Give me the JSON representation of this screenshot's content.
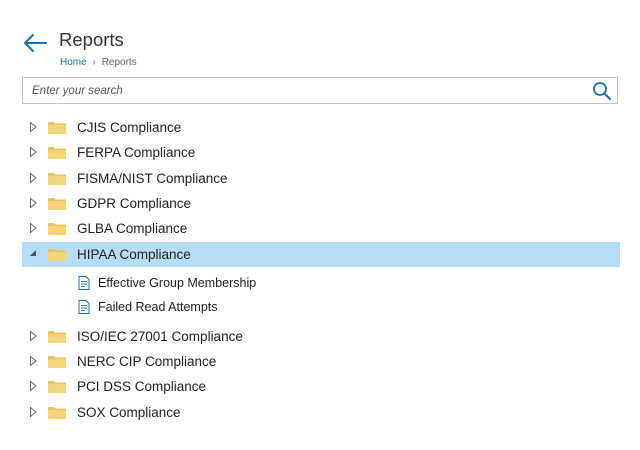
{
  "header": {
    "title": "Reports"
  },
  "breadcrumb": {
    "home": "Home",
    "separator": "›",
    "current": "Reports"
  },
  "search": {
    "placeholder": "Enter your search",
    "value": ""
  },
  "tree": {
    "folders": [
      {
        "label": "CJIS Compliance",
        "expanded": false,
        "selected": false
      },
      {
        "label": "FERPA Compliance",
        "expanded": false,
        "selected": false
      },
      {
        "label": "FISMA/NIST Compliance",
        "expanded": false,
        "selected": false
      },
      {
        "label": "GDPR Compliance",
        "expanded": false,
        "selected": false
      },
      {
        "label": "GLBA Compliance",
        "expanded": false,
        "selected": false
      },
      {
        "label": "HIPAA Compliance",
        "expanded": true,
        "selected": true,
        "children": [
          {
            "label": "Effective Group Membership"
          },
          {
            "label": "Failed Read Attempts"
          }
        ]
      },
      {
        "label": "ISO/IEC 27001 Compliance",
        "expanded": false,
        "selected": false
      },
      {
        "label": "NERC CIP Compliance",
        "expanded": false,
        "selected": false
      },
      {
        "label": "PCI DSS Compliance",
        "expanded": false,
        "selected": false
      },
      {
        "label": "SOX Compliance",
        "expanded": false,
        "selected": false
      }
    ]
  },
  "colors": {
    "accent": "#1a6fb5",
    "selected_row": "#b7dcf5",
    "folder": "#f5d478",
    "folder_tab": "#e9c35a",
    "search_border": "#b9c4cf"
  },
  "icons": {
    "back": "arrow-left-icon",
    "search": "magnifier-icon",
    "folder": "folder-icon",
    "report": "document-icon",
    "collapsed": "triangle-right-outline-icon",
    "expanded": "triangle-down-filled-icon"
  }
}
